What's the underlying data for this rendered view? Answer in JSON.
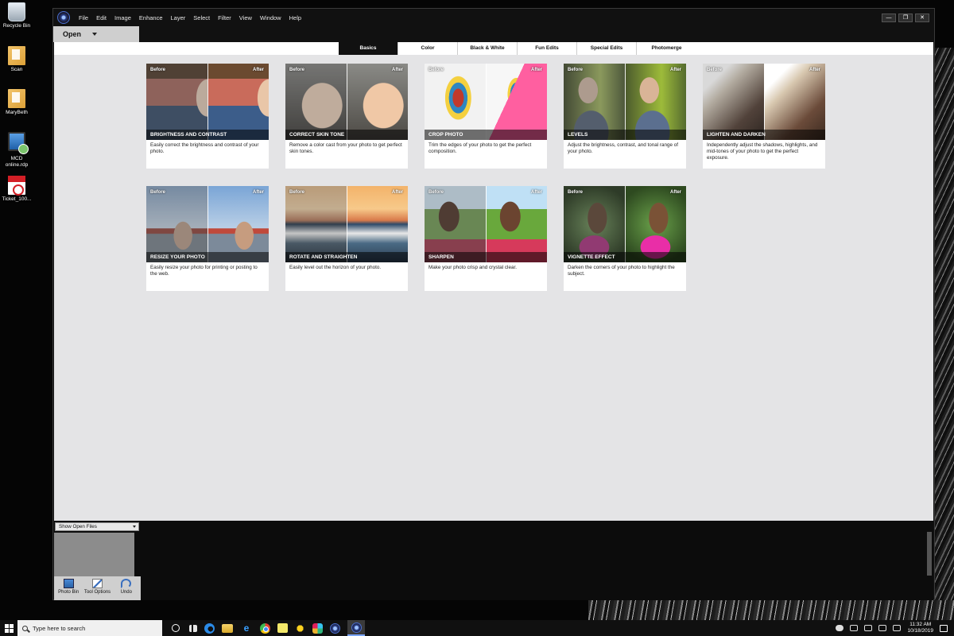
{
  "desktop": {
    "icons": [
      {
        "label": "Recycle Bin",
        "icon": "recycle-bin-icon"
      },
      {
        "label": "Scan",
        "icon": "folder-icon"
      },
      {
        "label": "MaryBeth",
        "icon": "folder-icon"
      },
      {
        "label": "MCD online.rdp",
        "icon": "remote-desktop-icon"
      },
      {
        "label": "Ticket_100...",
        "icon": "pdf-icon"
      }
    ]
  },
  "app": {
    "menu": [
      "File",
      "Edit",
      "Image",
      "Enhance",
      "Layer",
      "Select",
      "Filter",
      "View",
      "Window",
      "Help"
    ],
    "window_controls": {
      "minimize": "—",
      "maximize": "❐",
      "close": "✕"
    },
    "open_button": "Open",
    "tabs": [
      {
        "label": "Basics",
        "active": true
      },
      {
        "label": "Color",
        "active": false
      },
      {
        "label": "Black & White",
        "active": false
      },
      {
        "label": "Fun Edits",
        "active": false
      },
      {
        "label": "Special Edits",
        "active": false
      },
      {
        "label": "Photomerge",
        "active": false
      }
    ],
    "before_label": "Before",
    "after_label": "After",
    "edits": [
      {
        "title": "BRIGHTNESS AND CONTRAST",
        "desc": "Easily correct the brightness and contrast of your photo.",
        "scene": "s-face"
      },
      {
        "title": "CORRECT SKIN TONE",
        "desc": "Remove a color cast from your photo to get perfect skin tones.",
        "scene": "s-baby"
      },
      {
        "title": "CROP PHOTO",
        "desc": "Trim the edges of your photo to get the perfect composition.",
        "scene": "s-crop"
      },
      {
        "title": "LEVELS",
        "desc": "Adjust the brightness, contrast, and tonal range of your photo.",
        "scene": "s-levels"
      },
      {
        "title": "LIGHTEN AND DARKEN",
        "desc": "Independently adjust the shadows, highlights, and mid-tones of your photo to get the perfect exposure.",
        "scene": "s-lighten"
      },
      {
        "title": "RESIZE YOUR PHOTO",
        "desc": "Easily resize your photo for printing or posting to the web.",
        "scene": "s-resize"
      },
      {
        "title": "ROTATE AND STRAIGHTEN",
        "desc": "Easily level out the horizon of your photo.",
        "scene": "s-rotate"
      },
      {
        "title": "SHARPEN",
        "desc": "Make your photo crisp and crystal clear.",
        "scene": "s-sharpen"
      },
      {
        "title": "VIGNETTE EFFECT",
        "desc": "Darken the corners of your photo to highlight the subject.",
        "scene": "s-vignette"
      }
    ],
    "bin": {
      "dropdown": "Show Open Files",
      "buttons": [
        {
          "label": "Photo Bin",
          "icon": "photo-bin-icon"
        },
        {
          "label": "Tool Options",
          "icon": "tool-options-icon"
        },
        {
          "label": "Undo",
          "icon": "undo-icon"
        }
      ]
    }
  },
  "taskbar": {
    "search_placeholder": "Type here to search",
    "time": "11:32 AM",
    "date": "10/18/2019"
  }
}
